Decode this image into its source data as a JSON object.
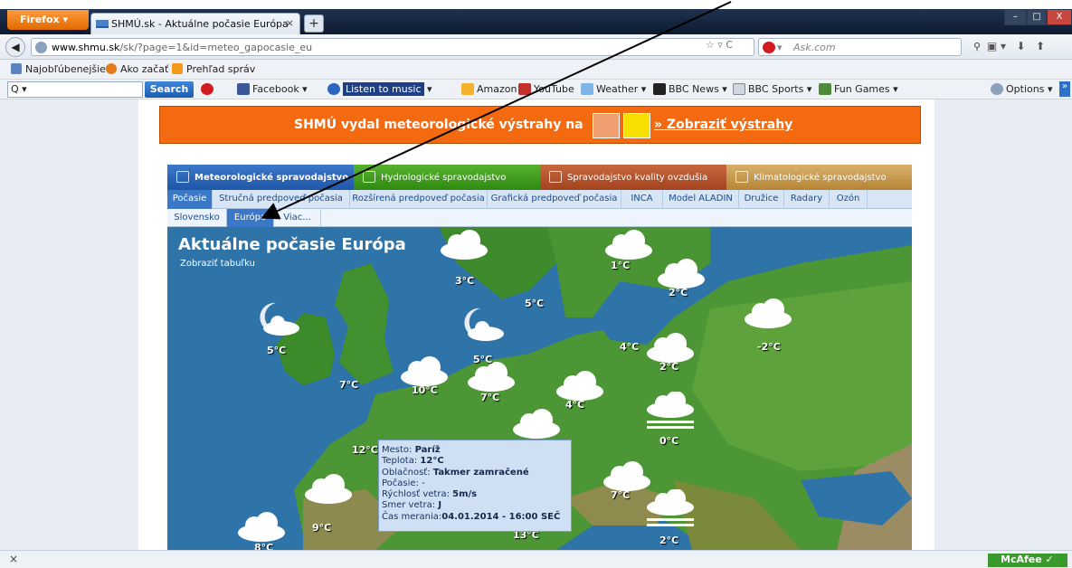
{
  "browser": {
    "menu_button": "Firefox",
    "tab_title": "SHMÚ.sk - Aktuálne počasie Európa",
    "new_tab": "+",
    "tab_close": "×",
    "url_domain": "www.shmu.sk",
    "url_path": "/sk/?page=1&id=meteo_gapocasie_eu",
    "search_engine_label": "Ask.com",
    "window_buttons": [
      "–",
      "□",
      "X"
    ]
  },
  "bookmarks": [
    {
      "label": "Najobľúbenejšie",
      "icon": "star-icon"
    },
    {
      "label": "Ako začať",
      "icon": "firefox-icon"
    },
    {
      "label": "Prehľad správ",
      "icon": "rss-icon"
    }
  ],
  "toolbar": {
    "search_placeholder": "Q ▾",
    "search_button": "Search",
    "items": [
      "Facebook ▾",
      "Listen to music",
      "Amazon",
      "YouTube",
      "Weather ▾",
      "BBC News ▾",
      "BBC Sports ▾",
      "Fun Games ▾"
    ],
    "options": "Options ▾"
  },
  "banner": {
    "text": "SHMÚ vydal meteorologické výstrahy na",
    "link": "» Zobraziť výstrahy"
  },
  "tabs_main": [
    {
      "label": "Meteorologické spravodajstvo",
      "color": "#2a62b4"
    },
    {
      "label": "Hydrologické spravodajstvo",
      "color": "#3d9d1c"
    },
    {
      "label": "Spravodajstvo kvality ovzdušia",
      "color": "#b8542e"
    },
    {
      "label": "Klimatologické spravodajstvo",
      "color": "#c79a46"
    }
  ],
  "tabs_sub": [
    "Počasie",
    "Stručná predpoveď počasia",
    "Rozšírená predpoveď počasia",
    "Grafická predpoveď počasia",
    "INCA",
    "Model ALADIN",
    "Družice",
    "Radary",
    "Ozón"
  ],
  "tabs_region": [
    "Slovensko",
    "Európa",
    "Viac..."
  ],
  "map": {
    "title": "Aktuálne počasie Európa",
    "link": "Zobraziť tabuľku",
    "temps": [
      "3°C",
      "1°C",
      "2°C",
      "5°C",
      "5°C",
      "5°C",
      "4°C",
      "-2°C",
      "2°C",
      "7°C",
      "10°C",
      "7°C",
      "4°C",
      "0°C",
      "12°C",
      "7°C",
      "9°C",
      "8°C",
      "13°C",
      "2°C"
    ]
  },
  "tooltip": {
    "city_label": "Mesto:",
    "city": "Paríž",
    "temp_label": "Teplota:",
    "temp": "12°C",
    "cloud_label": "Oblačnosť:",
    "cloud": "Takmer zamračené",
    "weather_label": "Počasie:",
    "weather": "-",
    "wind_speed_label": "Rýchlosť vetra:",
    "wind_speed": "5m/s",
    "wind_dir_label": "Smer vetra:",
    "wind_dir": "J",
    "time_label": "Čas merania:",
    "time": "04.01.2014 - 16:00 SEČ"
  },
  "status": {
    "close": "×",
    "mcafee": "McAfee"
  }
}
